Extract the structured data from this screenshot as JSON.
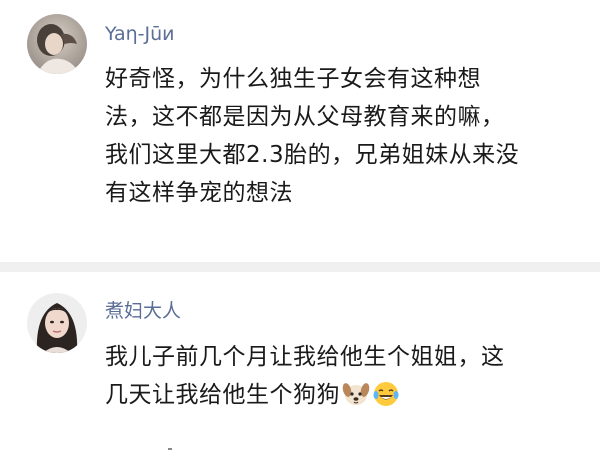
{
  "comments": [
    {
      "username": "Yaη-Jūи",
      "username_color": "#5a6e96",
      "avatar_icon": "user-avatar-photo-icon",
      "lines": [
        "好奇怪，为什么独生子女会有这种想",
        "法，这不都是因为从父母教育来的嘛，",
        "我们这里大都2.3胎的，兄弟姐妹从来没",
        "有这样争宠的想法"
      ]
    },
    {
      "username": "煮妇大人",
      "username_color": "#5a6e96",
      "avatar_icon": "user-avatar-photo-icon",
      "lines": [
        "我儿子前几个月让我给他生个姐姐，这",
        "几天让我给他生个狗狗"
      ],
      "emojis": [
        "dog-face-icon",
        "laughing-tears-icon"
      ]
    }
  ],
  "colors": {
    "text": "#1a1a1a",
    "divider": "#f0f0f0",
    "background": "#ffffff"
  }
}
